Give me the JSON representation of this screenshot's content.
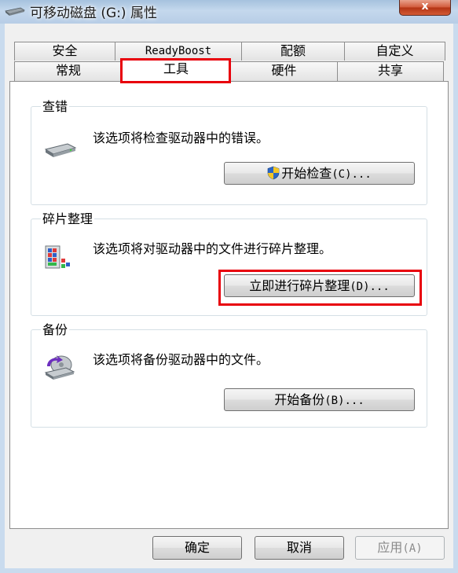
{
  "window": {
    "title": "可移动磁盘 (G:) 属性",
    "close_label": "x"
  },
  "tabs_row1": [
    {
      "label": "安全"
    },
    {
      "label": "ReadyBoost"
    },
    {
      "label": "配额"
    },
    {
      "label": "自定义"
    }
  ],
  "tabs_row2": [
    {
      "label": "常规"
    },
    {
      "label": "工具",
      "active": true
    },
    {
      "label": "硬件"
    },
    {
      "label": "共享"
    }
  ],
  "groups": {
    "error_check": {
      "title": "查错",
      "description": "该选项将检查驱动器中的错误。",
      "button_text": "开始检查",
      "button_shortcut": "(C)...",
      "icon": "drive-icon"
    },
    "defrag": {
      "title": "碎片整理",
      "description": "该选项将对驱动器中的文件进行碎片整理。",
      "button_text": "立即进行碎片整理",
      "button_shortcut": "(D)...",
      "icon": "defrag-icon"
    },
    "backup": {
      "title": "备份",
      "description": "该选项将备份驱动器中的文件。",
      "button_text": "开始备份",
      "button_shortcut": "(B)...",
      "icon": "backup-icon"
    }
  },
  "footer": {
    "ok_label": "确定",
    "cancel_label": "取消",
    "apply_label": "应用",
    "apply_shortcut": "(A)"
  },
  "colors": {
    "highlight": "#e8000b",
    "close_button": "#c9462b",
    "title_bar": "#b7cde6"
  }
}
